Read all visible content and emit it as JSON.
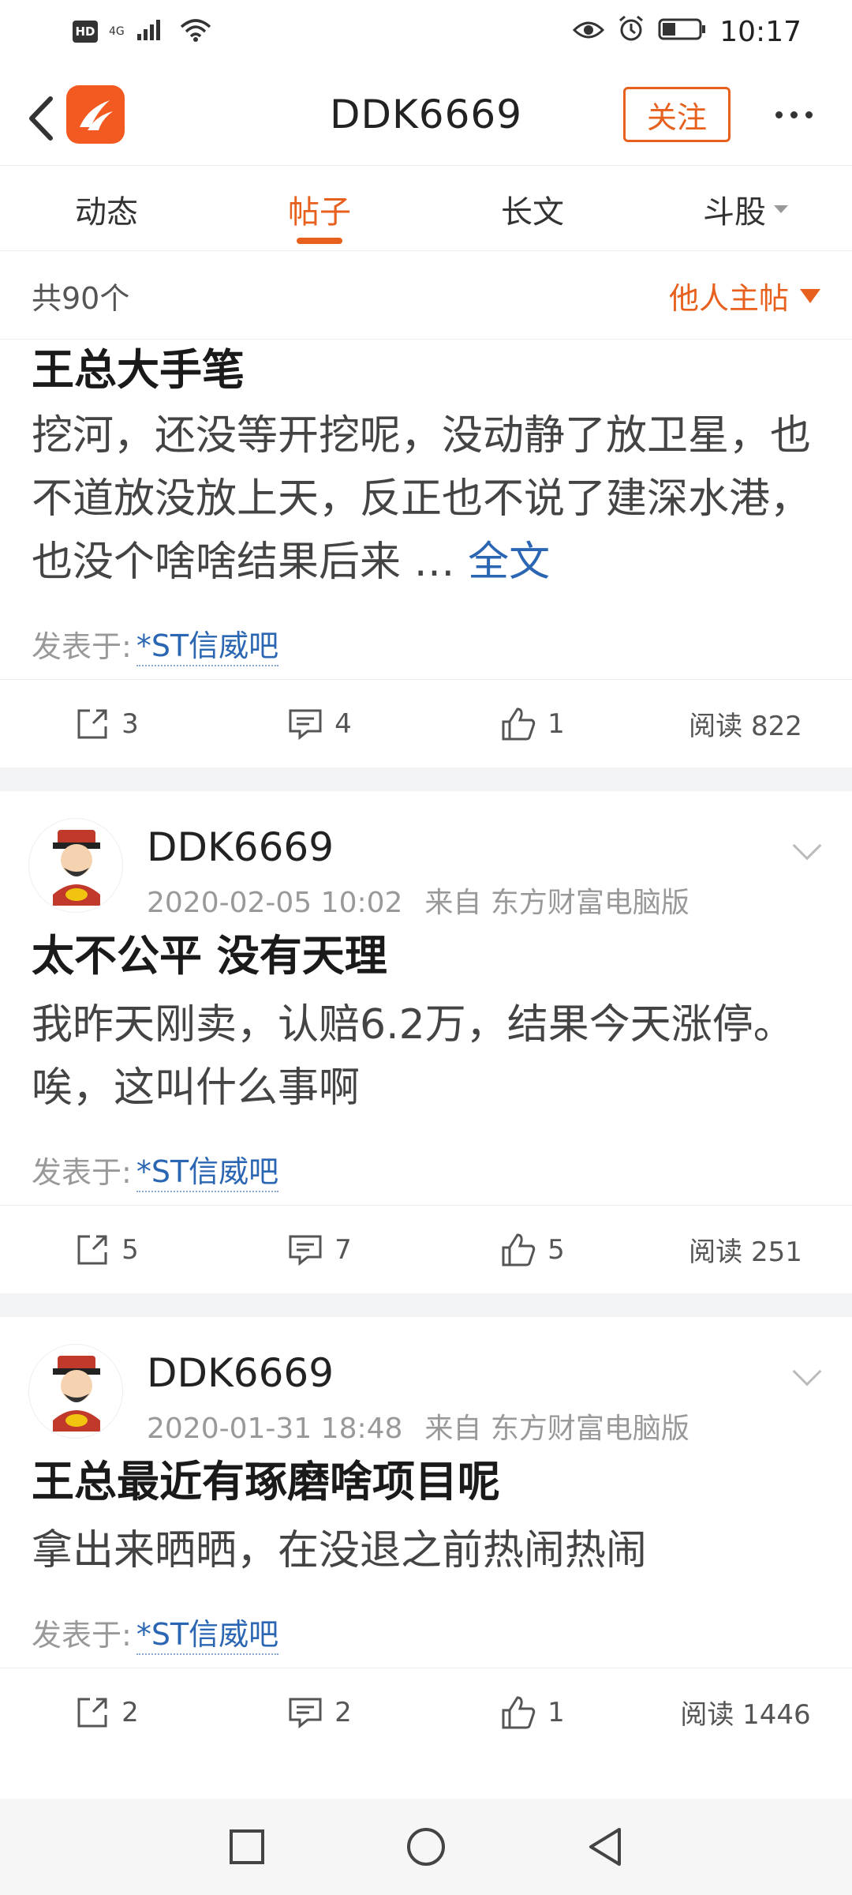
{
  "status_bar": {
    "hd": "HD",
    "network": "4G",
    "time": "10:17"
  },
  "header": {
    "title": "DDK6669",
    "follow_label": "关注"
  },
  "tabs": [
    {
      "label": "动态"
    },
    {
      "label": "帖子"
    },
    {
      "label": "长文"
    },
    {
      "label": "斗股"
    }
  ],
  "filter": {
    "total": "共90个",
    "selected": "他人主帖"
  },
  "posts": [
    {
      "title": "王总大手笔",
      "body": "挖河，还没等开挖呢，没动静了放卫星，也不道放没放上天，反正也不说了建深水港，也没个啥啥结果后来 …",
      "full_text_label": "全文",
      "posted_in_label": "发表于:",
      "forum": "*ST信威吧",
      "shares": "3",
      "comments": "4",
      "likes": "1",
      "reads": "阅读 822"
    },
    {
      "author": "DDK6669",
      "time": "2020-02-05 10:02",
      "source": "来自 东方财富电脑版",
      "title": "太不公平 没有天理",
      "body": "我昨天刚卖，认赔6.2万，结果今天涨停。唉，这叫什么事啊",
      "posted_in_label": "发表于:",
      "forum": "*ST信威吧",
      "shares": "5",
      "comments": "7",
      "likes": "5",
      "reads": "阅读 251"
    },
    {
      "author": "DDK6669",
      "time": "2020-01-31 18:48",
      "source": "来自 东方财富电脑版",
      "title": "王总最近有琢磨啥项目呢",
      "body": "拿出来晒晒，在没退之前热闹热闹",
      "posted_in_label": "发表于:",
      "forum": "*ST信威吧",
      "shares": "2",
      "comments": "2",
      "likes": "1",
      "reads": "阅读 1446"
    }
  ],
  "colors": {
    "accent": "#e8601d",
    "link": "#2b66b3"
  }
}
